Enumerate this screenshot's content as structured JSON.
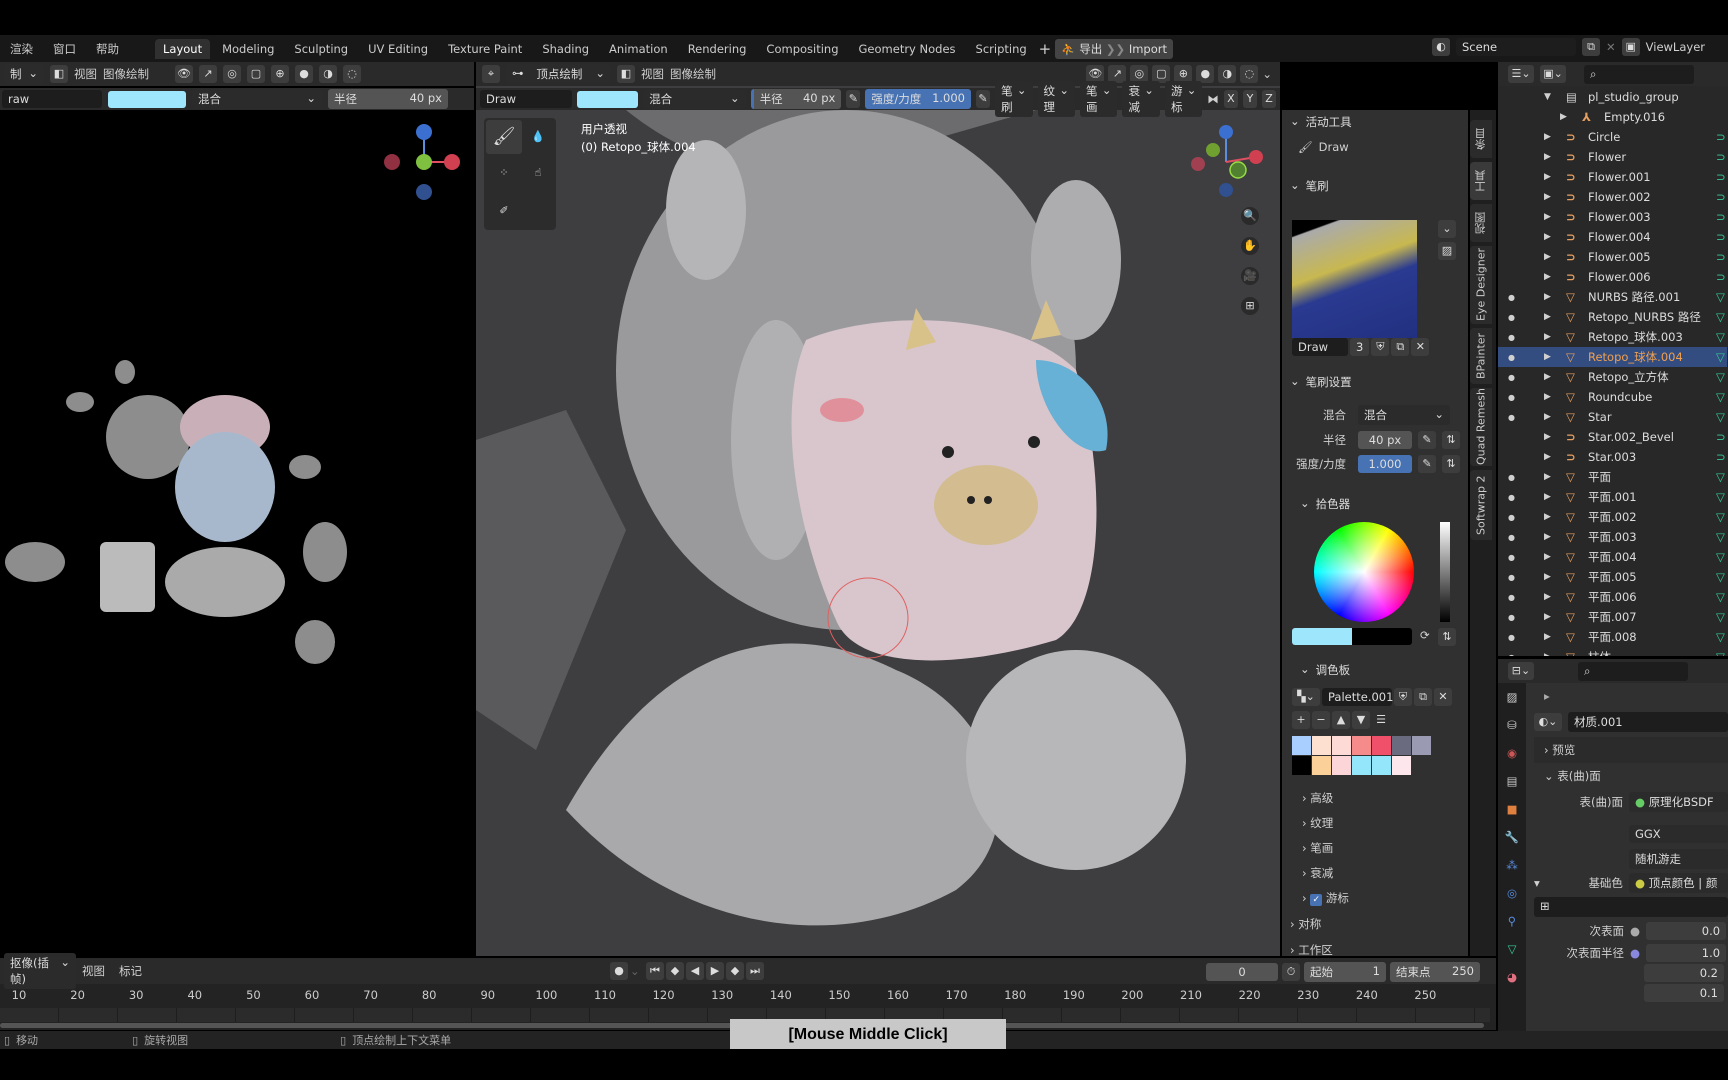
{
  "menu": {
    "items": [
      "渲染",
      "窗口",
      "帮助"
    ],
    "workspaces": [
      "Layout",
      "Modeling",
      "Sculpting",
      "UV Editing",
      "Texture Paint",
      "Shading",
      "Animation",
      "Rendering",
      "Compositing",
      "Geometry Nodes",
      "Scripting"
    ],
    "active_workspace": "Layout",
    "add_tab": "+",
    "export_label": "导出",
    "import_label": "Import",
    "scene": "Scene",
    "view_layer": "ViewLayer"
  },
  "left_view": {
    "mode": "制",
    "view": "视图",
    "paint": "图像绘制",
    "brush": "raw",
    "blend": "混合",
    "radius_label": "半径",
    "radius": "40 px"
  },
  "main_view": {
    "mode": "顶点绘制",
    "view": "视图",
    "paint": "图像绘制",
    "brush": "Draw",
    "brush_color": "#9de6fb",
    "blend": "混合",
    "radius_label": "半径",
    "radius": "40 px",
    "strength_label": "强度/力度",
    "strength": "1.000",
    "menus": [
      "笔刷",
      "纹理",
      "笔画",
      "衰减",
      "游标"
    ],
    "axes": [
      "X",
      "Y",
      "Z"
    ],
    "overlay_title": "用户透视",
    "overlay_object": "(0) Retopo_球体.004"
  },
  "npanel": {
    "active_tool_h": "活动工具",
    "active_tool": "Draw",
    "brush_h": "笔刷",
    "brush_name": "Draw",
    "brush_users": "3",
    "brush_settings_h": "笔刷设置",
    "blend_label": "混合",
    "blend": "混合",
    "radius_label": "半径",
    "radius": "40 px",
    "strength_label": "强度/力度",
    "strength": "1.000",
    "color_picker_h": "拾色器",
    "primary_color": "#9de6fb",
    "secondary_color": "#000000",
    "palette_h": "调色板",
    "palette_name": "Palette.001",
    "palette_colors": [
      "#a8cfff",
      "#fde0cf",
      "#fddad5",
      "#f58b8b",
      "#f0506a",
      "#6b6b80",
      "#9a9ab3",
      "#000000",
      "#fcd199",
      "#fcd5d8",
      "#94e6fb",
      "#94e6fb",
      "#fde6ec"
    ],
    "subpanels": [
      "高级",
      "纹理",
      "笔画",
      "衰减",
      "游标"
    ],
    "cursor_checked": true,
    "symmetry_h": "对称",
    "workspace_h": "工作区",
    "tabs": [
      "条目",
      "工具",
      "视图",
      "Eye Designer",
      "BPainter",
      "Quad Remesh",
      "Softwrap 2"
    ]
  },
  "outliner": {
    "items": [
      {
        "name": "pl_studio_group",
        "type": "collection"
      },
      {
        "name": "Empty.016",
        "type": "empty"
      },
      {
        "name": "Circle",
        "type": "curve"
      },
      {
        "name": "Flower",
        "type": "curve"
      },
      {
        "name": "Flower.001",
        "type": "curve"
      },
      {
        "name": "Flower.002",
        "type": "curve"
      },
      {
        "name": "Flower.003",
        "type": "curve"
      },
      {
        "name": "Flower.004",
        "type": "curve"
      },
      {
        "name": "Flower.005",
        "type": "curve"
      },
      {
        "name": "Flower.006",
        "type": "curve"
      },
      {
        "name": "NURBS 路径.001",
        "type": "mesh"
      },
      {
        "name": "Retopo_NURBS 路径",
        "type": "mesh"
      },
      {
        "name": "Retopo_球体.003",
        "type": "mesh"
      },
      {
        "name": "Retopo_球体.004",
        "type": "mesh",
        "selected": true
      },
      {
        "name": "Retopo_立方体",
        "type": "mesh"
      },
      {
        "name": "Roundcube",
        "type": "mesh"
      },
      {
        "name": "Star",
        "type": "mesh"
      },
      {
        "name": "Star.002_Bevel",
        "type": "curve"
      },
      {
        "name": "Star.003",
        "type": "curve"
      },
      {
        "name": "平面",
        "type": "mesh"
      },
      {
        "name": "平面.001",
        "type": "mesh"
      },
      {
        "name": "平面.002",
        "type": "mesh"
      },
      {
        "name": "平面.003",
        "type": "mesh"
      },
      {
        "name": "平面.004",
        "type": "mesh"
      },
      {
        "name": "平面.005",
        "type": "mesh"
      },
      {
        "name": "平面.006",
        "type": "mesh"
      },
      {
        "name": "平面.007",
        "type": "mesh"
      },
      {
        "name": "平面.008",
        "type": "mesh"
      },
      {
        "name": "柱体",
        "type": "mesh"
      }
    ]
  },
  "properties": {
    "material": "材质.001",
    "preview_h": "预览",
    "surface_h": "表(曲)面",
    "surface_label": "表(曲)面",
    "surface": "原理化BSDF",
    "distribution": "GGX",
    "subsurface_method": "随机游走",
    "base_color_label": "基础色",
    "base_color": "顶点颜色 | 颜",
    "subsurface_label": "次表面",
    "subsurface": "0.0",
    "subsurface_radius_label": "次表面半径",
    "subsurface_radius": [
      "1.0",
      "0.2",
      "0.1"
    ]
  },
  "timeline": {
    "mode": "抠像(插帧)",
    "view": "视图",
    "marker": "标记",
    "current_frame": "0",
    "start_label": "起始",
    "start": "1",
    "end_label": "结束点",
    "end": "250",
    "ticks": [
      "10",
      "20",
      "30",
      "40",
      "50",
      "60",
      "70",
      "80",
      "90",
      "100",
      "110",
      "120",
      "130",
      "140",
      "150",
      "160",
      "170",
      "180",
      "190",
      "200",
      "210",
      "220",
      "230",
      "240",
      "250"
    ]
  },
  "status": {
    "move": "移动",
    "rotate": "旋转视图",
    "context": "顶点绘制上下文菜单",
    "overlay": "[Mouse Middle Click]"
  }
}
